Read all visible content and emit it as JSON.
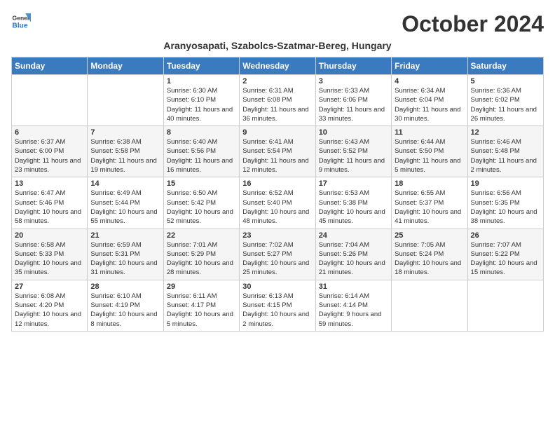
{
  "header": {
    "logo_line1": "General",
    "logo_line2": "Blue",
    "month_title": "October 2024",
    "subtitle": "Aranyosapati, Szabolcs-Szatmar-Bereg, Hungary"
  },
  "weekdays": [
    "Sunday",
    "Monday",
    "Tuesday",
    "Wednesday",
    "Thursday",
    "Friday",
    "Saturday"
  ],
  "weeks": [
    [
      {
        "day": "",
        "info": ""
      },
      {
        "day": "",
        "info": ""
      },
      {
        "day": "1",
        "info": "Sunrise: 6:30 AM\nSunset: 6:10 PM\nDaylight: 11 hours and 40 minutes."
      },
      {
        "day": "2",
        "info": "Sunrise: 6:31 AM\nSunset: 6:08 PM\nDaylight: 11 hours and 36 minutes."
      },
      {
        "day": "3",
        "info": "Sunrise: 6:33 AM\nSunset: 6:06 PM\nDaylight: 11 hours and 33 minutes."
      },
      {
        "day": "4",
        "info": "Sunrise: 6:34 AM\nSunset: 6:04 PM\nDaylight: 11 hours and 30 minutes."
      },
      {
        "day": "5",
        "info": "Sunrise: 6:36 AM\nSunset: 6:02 PM\nDaylight: 11 hours and 26 minutes."
      }
    ],
    [
      {
        "day": "6",
        "info": "Sunrise: 6:37 AM\nSunset: 6:00 PM\nDaylight: 11 hours and 23 minutes."
      },
      {
        "day": "7",
        "info": "Sunrise: 6:38 AM\nSunset: 5:58 PM\nDaylight: 11 hours and 19 minutes."
      },
      {
        "day": "8",
        "info": "Sunrise: 6:40 AM\nSunset: 5:56 PM\nDaylight: 11 hours and 16 minutes."
      },
      {
        "day": "9",
        "info": "Sunrise: 6:41 AM\nSunset: 5:54 PM\nDaylight: 11 hours and 12 minutes."
      },
      {
        "day": "10",
        "info": "Sunrise: 6:43 AM\nSunset: 5:52 PM\nDaylight: 11 hours and 9 minutes."
      },
      {
        "day": "11",
        "info": "Sunrise: 6:44 AM\nSunset: 5:50 PM\nDaylight: 11 hours and 5 minutes."
      },
      {
        "day": "12",
        "info": "Sunrise: 6:46 AM\nSunset: 5:48 PM\nDaylight: 11 hours and 2 minutes."
      }
    ],
    [
      {
        "day": "13",
        "info": "Sunrise: 6:47 AM\nSunset: 5:46 PM\nDaylight: 10 hours and 58 minutes."
      },
      {
        "day": "14",
        "info": "Sunrise: 6:49 AM\nSunset: 5:44 PM\nDaylight: 10 hours and 55 minutes."
      },
      {
        "day": "15",
        "info": "Sunrise: 6:50 AM\nSunset: 5:42 PM\nDaylight: 10 hours and 52 minutes."
      },
      {
        "day": "16",
        "info": "Sunrise: 6:52 AM\nSunset: 5:40 PM\nDaylight: 10 hours and 48 minutes."
      },
      {
        "day": "17",
        "info": "Sunrise: 6:53 AM\nSunset: 5:38 PM\nDaylight: 10 hours and 45 minutes."
      },
      {
        "day": "18",
        "info": "Sunrise: 6:55 AM\nSunset: 5:37 PM\nDaylight: 10 hours and 41 minutes."
      },
      {
        "day": "19",
        "info": "Sunrise: 6:56 AM\nSunset: 5:35 PM\nDaylight: 10 hours and 38 minutes."
      }
    ],
    [
      {
        "day": "20",
        "info": "Sunrise: 6:58 AM\nSunset: 5:33 PM\nDaylight: 10 hours and 35 minutes."
      },
      {
        "day": "21",
        "info": "Sunrise: 6:59 AM\nSunset: 5:31 PM\nDaylight: 10 hours and 31 minutes."
      },
      {
        "day": "22",
        "info": "Sunrise: 7:01 AM\nSunset: 5:29 PM\nDaylight: 10 hours and 28 minutes."
      },
      {
        "day": "23",
        "info": "Sunrise: 7:02 AM\nSunset: 5:27 PM\nDaylight: 10 hours and 25 minutes."
      },
      {
        "day": "24",
        "info": "Sunrise: 7:04 AM\nSunset: 5:26 PM\nDaylight: 10 hours and 21 minutes."
      },
      {
        "day": "25",
        "info": "Sunrise: 7:05 AM\nSunset: 5:24 PM\nDaylight: 10 hours and 18 minutes."
      },
      {
        "day": "26",
        "info": "Sunrise: 7:07 AM\nSunset: 5:22 PM\nDaylight: 10 hours and 15 minutes."
      }
    ],
    [
      {
        "day": "27",
        "info": "Sunrise: 6:08 AM\nSunset: 4:20 PM\nDaylight: 10 hours and 12 minutes."
      },
      {
        "day": "28",
        "info": "Sunrise: 6:10 AM\nSunset: 4:19 PM\nDaylight: 10 hours and 8 minutes."
      },
      {
        "day": "29",
        "info": "Sunrise: 6:11 AM\nSunset: 4:17 PM\nDaylight: 10 hours and 5 minutes."
      },
      {
        "day": "30",
        "info": "Sunrise: 6:13 AM\nSunset: 4:15 PM\nDaylight: 10 hours and 2 minutes."
      },
      {
        "day": "31",
        "info": "Sunrise: 6:14 AM\nSunset: 4:14 PM\nDaylight: 9 hours and 59 minutes."
      },
      {
        "day": "",
        "info": ""
      },
      {
        "day": "",
        "info": ""
      }
    ]
  ]
}
